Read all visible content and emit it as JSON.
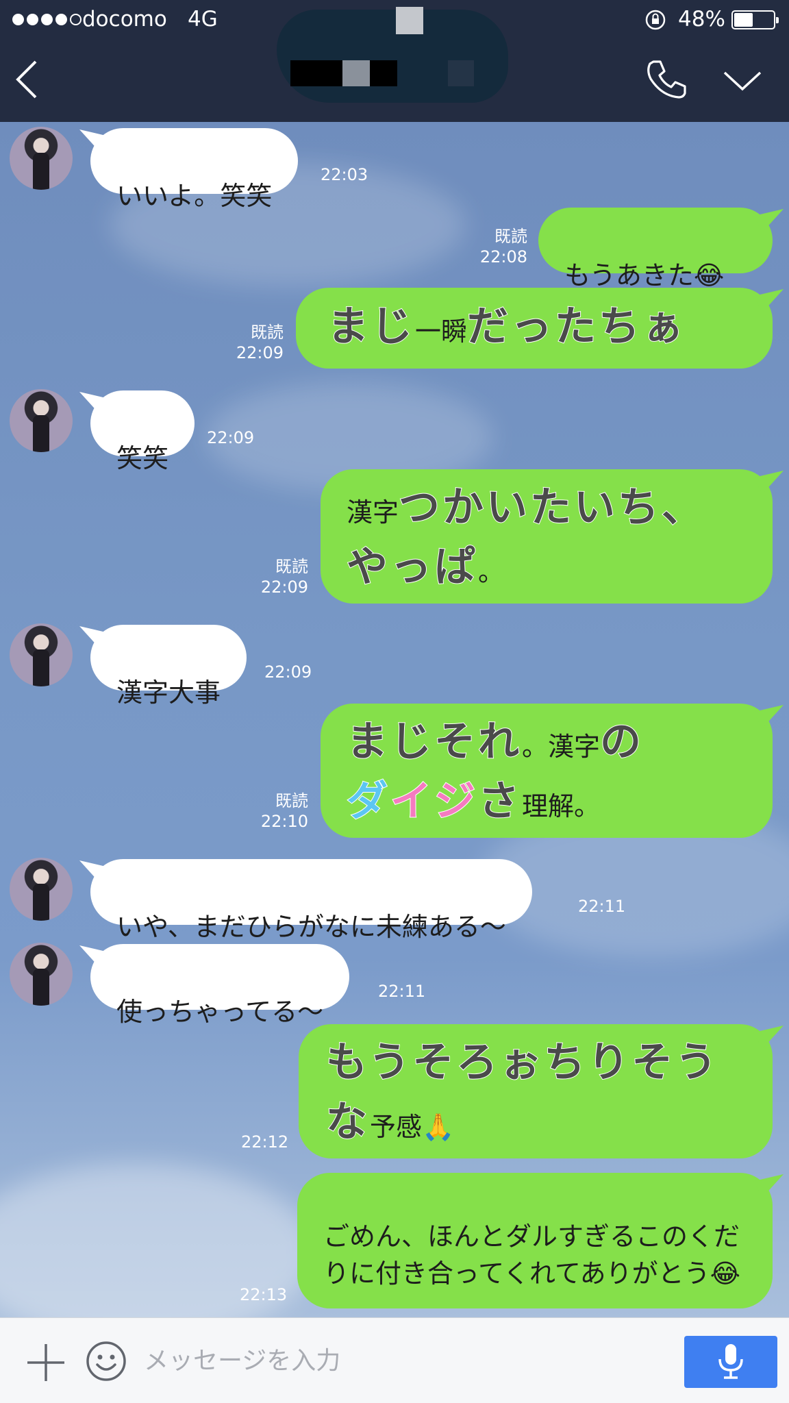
{
  "status_bar": {
    "carrier": "docomo",
    "network": "4G",
    "battery": "48%",
    "battery_level": 0.48
  },
  "header": {
    "back_icon": "chevron-left-icon",
    "call_icon": "phone-icon",
    "menu_icon": "chevron-down-icon"
  },
  "messages": [
    {
      "side": "in",
      "text": "いいよ。笑笑",
      "time": "22:03"
    },
    {
      "side": "out",
      "text": "もうあきた😂",
      "read": "既読",
      "time": "22:08"
    },
    {
      "side": "out",
      "parts": [
        "まじ",
        "一瞬",
        "だったちぁ"
      ],
      "read": "既読",
      "time": "22:09"
    },
    {
      "side": "in",
      "text": "笑笑",
      "time": "22:09"
    },
    {
      "side": "out",
      "parts": [
        "漢字",
        "つかいたいち、",
        "やっぱ",
        "。"
      ],
      "read": "既読",
      "time": "22:09"
    },
    {
      "side": "in",
      "text": "漢字大事",
      "time": "22:09"
    },
    {
      "side": "out",
      "parts": [
        "まじそれ",
        "。漢字",
        "の",
        "ダイジ",
        "さ",
        "理解。"
      ],
      "read": "既読",
      "time": "22:10"
    },
    {
      "side": "in",
      "text": "いや、まだひらがなに未練ある〜",
      "time": "22:11"
    },
    {
      "side": "in",
      "text": "使っちゃってる〜",
      "time": "22:11"
    },
    {
      "side": "out",
      "parts": [
        "もうそろぉちりそうな",
        "予感🙏"
      ],
      "time": "22:12"
    },
    {
      "side": "out",
      "text": "ごめん、ほんとダルすぎるこのくだりに付き合ってくれてありがとう😂",
      "time": "22:13"
    }
  ],
  "input": {
    "placeholder": "メッセージを入力",
    "plus_icon": "plus-icon",
    "sticker_icon": "smile-icon",
    "mic_icon": "microphone-icon"
  }
}
